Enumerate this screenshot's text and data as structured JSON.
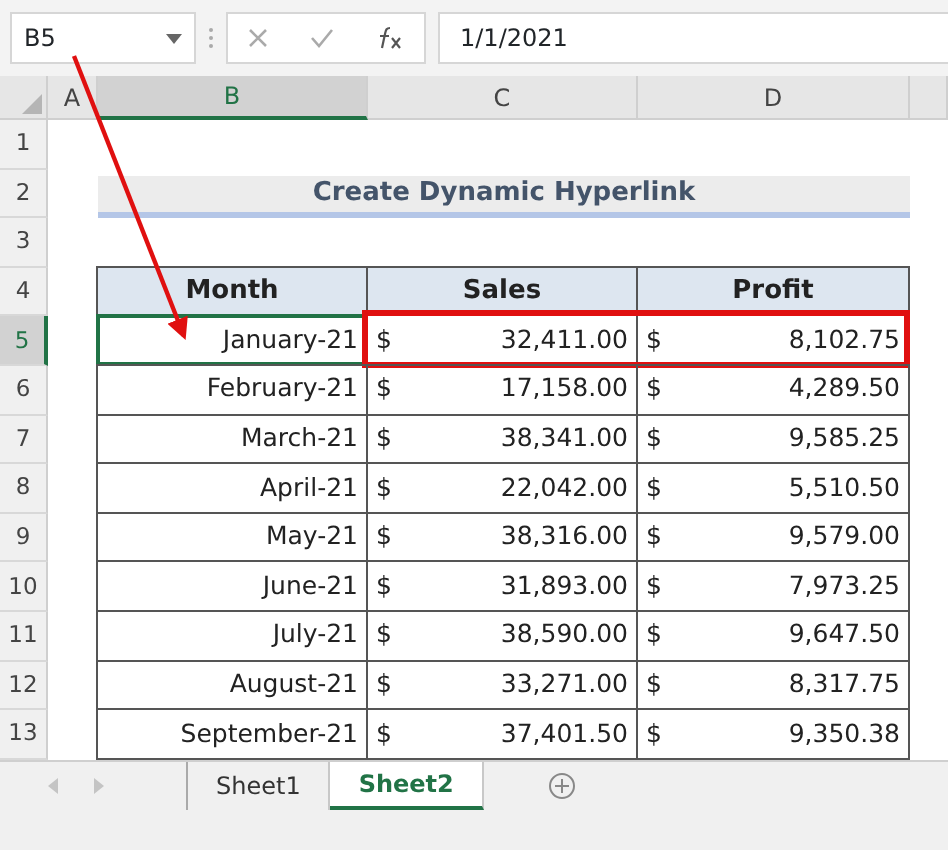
{
  "name_box": {
    "value": "B5"
  },
  "formula_bar": {
    "value": "1/1/2021"
  },
  "column_headers": [
    {
      "label": "A",
      "selected": false
    },
    {
      "label": "B",
      "selected": true
    },
    {
      "label": "C",
      "selected": false
    },
    {
      "label": "D",
      "selected": false
    }
  ],
  "row_headers": [
    {
      "label": "1",
      "selected": false
    },
    {
      "label": "2",
      "selected": false
    },
    {
      "label": "3",
      "selected": false
    },
    {
      "label": "4",
      "selected": false
    },
    {
      "label": "5",
      "selected": true
    },
    {
      "label": "6",
      "selected": false
    },
    {
      "label": "7",
      "selected": false
    },
    {
      "label": "8",
      "selected": false
    },
    {
      "label": "9",
      "selected": false
    },
    {
      "label": "10",
      "selected": false
    },
    {
      "label": "11",
      "selected": false
    },
    {
      "label": "12",
      "selected": false
    },
    {
      "label": "13",
      "selected": false
    }
  ],
  "title": "Create Dynamic Hyperlink",
  "table": {
    "columns": [
      "Month",
      "Sales",
      "Profit"
    ],
    "rows": [
      {
        "month": "January-21",
        "sales_currency": "$",
        "sales": "32,411.00",
        "profit_currency": "$",
        "profit": "8,102.75",
        "selected": true,
        "highlighted": true
      },
      {
        "month": "February-21",
        "sales_currency": "$",
        "sales": "17,158.00",
        "profit_currency": "$",
        "profit": "4,289.50",
        "selected": false,
        "highlighted": false
      },
      {
        "month": "March-21",
        "sales_currency": "$",
        "sales": "38,341.00",
        "profit_currency": "$",
        "profit": "9,585.25",
        "selected": false,
        "highlighted": false
      },
      {
        "month": "April-21",
        "sales_currency": "$",
        "sales": "22,042.00",
        "profit_currency": "$",
        "profit": "5,510.50",
        "selected": false,
        "highlighted": false
      },
      {
        "month": "May-21",
        "sales_currency": "$",
        "sales": "38,316.00",
        "profit_currency": "$",
        "profit": "9,579.00",
        "selected": false,
        "highlighted": false
      },
      {
        "month": "June-21",
        "sales_currency": "$",
        "sales": "31,893.00",
        "profit_currency": "$",
        "profit": "7,973.25",
        "selected": false,
        "highlighted": false
      },
      {
        "month": "July-21",
        "sales_currency": "$",
        "sales": "38,590.00",
        "profit_currency": "$",
        "profit": "9,647.50",
        "selected": false,
        "highlighted": false
      },
      {
        "month": "August-21",
        "sales_currency": "$",
        "sales": "33,271.00",
        "profit_currency": "$",
        "profit": "8,317.75",
        "selected": false,
        "highlighted": false
      },
      {
        "month": "September-21",
        "sales_currency": "$",
        "sales": "37,401.50",
        "profit_currency": "$",
        "profit": "9,350.38",
        "selected": false,
        "highlighted": false
      }
    ]
  },
  "sheet_tabs": [
    {
      "label": "Sheet1",
      "selected": false
    },
    {
      "label": "Sheet2",
      "selected": true
    }
  ]
}
